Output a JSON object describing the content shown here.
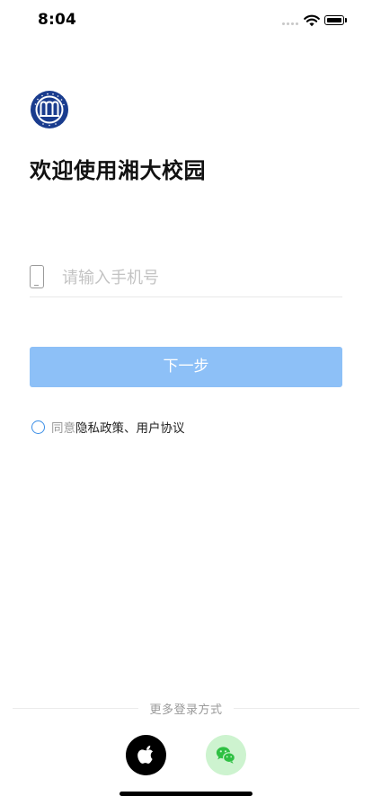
{
  "status_bar": {
    "time": "8:04"
  },
  "logo": {
    "name": "university-seal-logo",
    "text": "XIANGTAN UNIVERSITY 湘潭大学",
    "color": "#1a3c8e"
  },
  "title": "欢迎使用湘大校园",
  "phone": {
    "placeholder": "请输入手机号",
    "value": "",
    "icon": "phone-icon"
  },
  "next_button": {
    "label": "下一步",
    "color": "#8dc0f7"
  },
  "agreement": {
    "checked": false,
    "prefix": "同意",
    "links": "隐私政策、用户协议",
    "accent": "#3a8ee6"
  },
  "more_login": {
    "label": "更多登录方式",
    "options": [
      {
        "icon": "apple-icon"
      },
      {
        "icon": "wechat-icon"
      }
    ],
    "wechat_color": "#2fc043"
  }
}
